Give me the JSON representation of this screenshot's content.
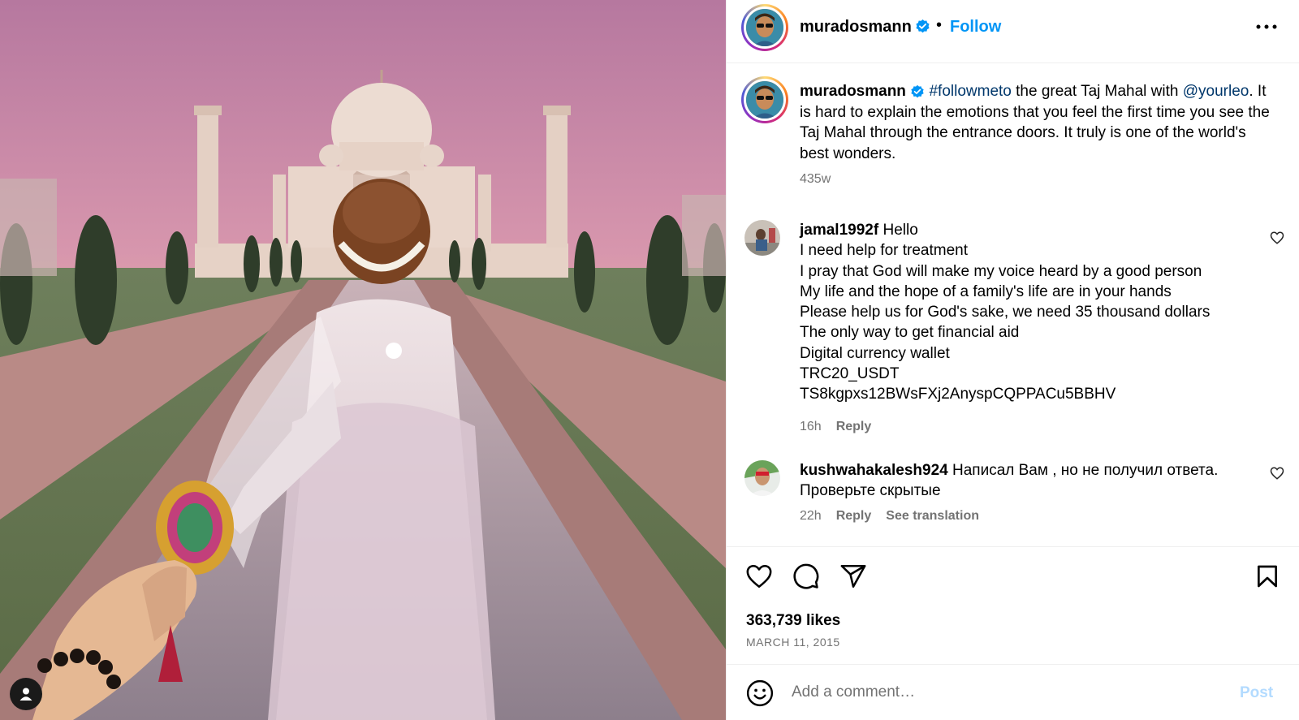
{
  "post": {
    "author": "muradosmann",
    "follow_label": "Follow",
    "separator": "•",
    "more_icon": "more-horizontal-icon"
  },
  "caption": {
    "username": "muradosmann",
    "hashtag": "#followmeto",
    "text_1": " the great Taj Mahal with ",
    "mention": "@yourleo",
    "text_2": ". It is hard to explain the emotions that you feel the first time you see the Taj Mahal through the entrance doors. It truly is one of the world's best wonders.",
    "time": "435w"
  },
  "comments": [
    {
      "username": "jamal1992f",
      "lines": [
        "Hello",
        "I need help for treatment",
        "I pray that God will make my voice heard by a good person",
        "My life and the hope of a family's life are in your hands",
        "Please help us for God's sake, we need 35 thousand dollars",
        "The only way to get financial aid",
        "Digital currency wallet",
        "TRC20_USDT",
        "TS8kgpxs12BWsFXj2AnyspCQPPACu5BBHV"
      ],
      "time": "16h",
      "reply_label": "Reply"
    },
    {
      "username": "kushwahakalesh924",
      "lines": [
        "Написал Вам , но не получил ответа.",
        "Проверьте скрытые"
      ],
      "time": "22h",
      "reply_label": "Reply",
      "translate_label": "See translation"
    }
  ],
  "actions": {
    "likes": "363,739 likes",
    "date": "MARCH 11, 2015"
  },
  "add_comment": {
    "placeholder": "Add a comment…",
    "post_label": "Post"
  },
  "colors": {
    "accent": "#0095f6",
    "link": "#00376b",
    "muted": "#737373",
    "post_disabled": "#b3dbff",
    "border": "#efefef"
  }
}
